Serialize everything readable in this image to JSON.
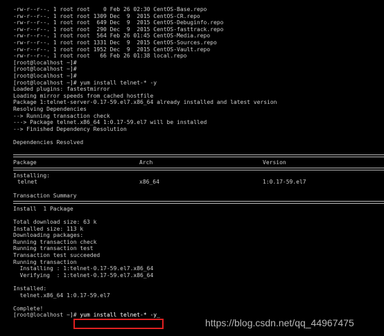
{
  "terminal": {
    "ls_lines": [
      "-rw-r--r--. 1 root root    0 Feb 26 02:30 CentOS-Base.repo",
      "-rw-r--r--. 1 root root 1309 Dec  9  2015 CentOS-CR.repo",
      "-rw-r--r--. 1 root root  649 Dec  9  2015 CentOS-Debuginfo.repo",
      "-rw-r--r--. 1 root root  290 Dec  9  2015 CentOS-fasttrack.repo",
      "-rw-r--r--. 1 root root  564 Feb 26 01:45 CentOS-Media.repo",
      "-rw-r--r--. 1 root root 1331 Dec  9  2015 CentOS-Sources.repo",
      "-rw-r--r--. 1 root root 1952 Dec  9  2015 CentOS-Vault.repo",
      "-rw-r--r--. 1 root root   66 Feb 26 01:38 local.repo"
    ],
    "prompt_lines": [
      "[root@localhost ~]#",
      "[root@localhost ~]#",
      "[root@localhost ~]#"
    ],
    "install_cmd": "[root@localhost ~]# yum install telnet-* -y",
    "yum_lines": [
      "Loaded plugins: fastestmirror",
      "Loading mirror speeds from cached hostfile",
      "Package 1:telnet-server-0.17-59.el7.x86_64 already installed and latest version",
      "Resolving Dependencies",
      "--> Running transaction check",
      "---> Package telnet.x86_64 1:0.17-59.el7 will be installed",
      "--> Finished Dependency Resolution",
      "",
      "Dependencies Resolved",
      ""
    ],
    "table": {
      "headers": [
        "Package",
        "Arch",
        "Version"
      ],
      "installing_label": "Installing:",
      "row": [
        "telnet",
        "x86_64",
        "1:0.17-59.el7"
      ]
    },
    "summary_title": "Transaction Summary",
    "summary_line": "Install  1 Package",
    "download_lines": [
      "Total download size: 63 k",
      "Installed size: 113 k",
      "Downloading packages:",
      "Running transaction check",
      "Running transaction test",
      "Transaction test succeeded",
      "Running transaction",
      "  Installing : 1:telnet-0.17-59.el7.x86_64",
      "  Verifying  : 1:telnet-0.17-59.el7.x86_64",
      "",
      "Installed:",
      "  telnet.x86_64 1:0.17-59.el7",
      "",
      "Complete!"
    ],
    "final_prompt": "[root@localhost ~]# ",
    "final_cmd": "yum install telnet-* -y_"
  },
  "watermark": "https://blog.csdn.net/qq_44967475",
  "colors": {
    "background": "#000000",
    "text": "#cfcfcf",
    "highlight": "#e02020"
  }
}
